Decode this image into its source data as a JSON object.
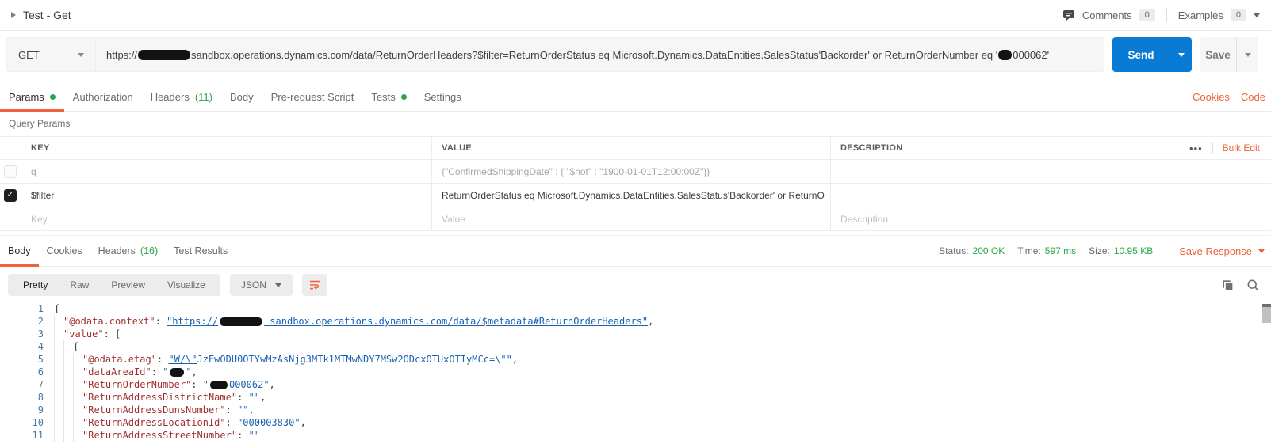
{
  "colors": {
    "accent_orange": "#f0613c",
    "success_green": "#28a745",
    "send_blue": "#0a7bd4",
    "redaction_black": "#131313"
  },
  "header": {
    "request_name": "Test - Get",
    "comments": {
      "label": "Comments",
      "count": "0"
    },
    "examples": {
      "label": "Examples",
      "count": "0"
    }
  },
  "request": {
    "method": "GET",
    "url": {
      "scheme": "https://",
      "rest": "sandbox.operations.dynamics.com/data/ReturnOrderHeaders?$filter=ReturnOrderStatus eq Microsoft.Dynamics.DataEntities.SalesStatus'Backorder' or ReturnOrderNumber eq '",
      "suffix": "000062'"
    },
    "send_label": "Send",
    "save_label": "Save"
  },
  "request_tabs": [
    {
      "label": "Params",
      "dot": true,
      "active": true
    },
    {
      "label": "Authorization"
    },
    {
      "label": "Headers",
      "badge": "(11)"
    },
    {
      "label": "Body"
    },
    {
      "label": "Pre-request Script"
    },
    {
      "label": "Tests",
      "dot": true
    },
    {
      "label": "Settings"
    }
  ],
  "request_links": {
    "cookies": "Cookies",
    "code": "Code"
  },
  "query_params": {
    "title": "Query Params",
    "columns": {
      "key": "KEY",
      "value": "VALUE",
      "description": "DESCRIPTION"
    },
    "more_icon": "•••",
    "bulk_edit": "Bulk Edit",
    "rows": [
      {
        "key": "q",
        "value": "{\"ConfirmedShippingDate\" : { \"$not\" : \"1900-01-01T12:00:00Z\"}}",
        "checked": false
      },
      {
        "key": "$filter",
        "value": "ReturnOrderStatus eq Microsoft.Dynamics.DataEntities.SalesStatus'Backorder' or ReturnO",
        "checked": true
      },
      {
        "key_placeholder": "Key",
        "value_placeholder": "Value",
        "description_placeholder": "Description"
      }
    ]
  },
  "response": {
    "tabs": [
      {
        "label": "Body",
        "active": true
      },
      {
        "label": "Cookies"
      },
      {
        "label": "Headers",
        "badge": "(16)"
      },
      {
        "label": "Test Results"
      }
    ],
    "meta": {
      "status_label": "Status:",
      "status_value": "200 OK",
      "time_label": "Time:",
      "time_value": "597 ms",
      "size_label": "Size:",
      "size_value": "10.95 KB",
      "save_response": "Save Response"
    },
    "toolbar": {
      "views": [
        {
          "label": "Pretty",
          "active": true
        },
        {
          "label": "Raw"
        },
        {
          "label": "Preview"
        },
        {
          "label": "Visualize"
        }
      ],
      "format": "JSON"
    },
    "code": {
      "lines": [
        {
          "num": "1",
          "indent": 0,
          "tokens": [
            {
              "t": "punc",
              "v": "{"
            }
          ]
        },
        {
          "num": "2",
          "indent": 1,
          "tokens": [
            {
              "t": "key",
              "v": "\"@odata.context\""
            },
            {
              "t": "punc",
              "v": ": "
            },
            {
              "t": "link",
              "v": "\"https://"
            },
            {
              "t": "redact",
              "w": 54
            },
            {
              "t": "link",
              "v": " sandbox.operations.dynamics.com/data/$metadata#ReturnOrderHeaders\""
            },
            {
              "t": "punc",
              "v": ","
            }
          ]
        },
        {
          "num": "3",
          "indent": 1,
          "tokens": [
            {
              "t": "key",
              "v": "\"value\""
            },
            {
              "t": "punc",
              "v": ": ["
            }
          ]
        },
        {
          "num": "4",
          "indent": 2,
          "tokens": [
            {
              "t": "punc",
              "v": "{"
            }
          ]
        },
        {
          "num": "5",
          "indent": 3,
          "tokens": [
            {
              "t": "key",
              "v": "\"@odata.etag\""
            },
            {
              "t": "punc",
              "v": ": "
            },
            {
              "t": "stru",
              "v": "\"W/\\\""
            },
            {
              "t": "str",
              "v": "JzEwODU0OTYwMzAsNjg3MTk1MTMwNDY7MSw2ODcxOTUxOTIyMCc=\\\"\""
            },
            {
              "t": "punc",
              "v": ","
            }
          ]
        },
        {
          "num": "6",
          "indent": 3,
          "tokens": [
            {
              "t": "key",
              "v": "\"dataAreaId\""
            },
            {
              "t": "punc",
              "v": ": "
            },
            {
              "t": "str",
              "v": "\""
            },
            {
              "t": "redact",
              "w": 18
            },
            {
              "t": "str",
              "v": "\""
            },
            {
              "t": "punc",
              "v": ","
            }
          ]
        },
        {
          "num": "7",
          "indent": 3,
          "tokens": [
            {
              "t": "key",
              "v": "\"ReturnOrderNumber\""
            },
            {
              "t": "punc",
              "v": ": "
            },
            {
              "t": "str",
              "v": "\""
            },
            {
              "t": "redact",
              "w": 22
            },
            {
              "t": "str",
              "v": "000062\""
            },
            {
              "t": "punc",
              "v": ","
            }
          ]
        },
        {
          "num": "8",
          "indent": 3,
          "tokens": [
            {
              "t": "key",
              "v": "\"ReturnAddressDistrictName\""
            },
            {
              "t": "punc",
              "v": ": "
            },
            {
              "t": "str",
              "v": "\"\""
            },
            {
              "t": "punc",
              "v": ","
            }
          ]
        },
        {
          "num": "9",
          "indent": 3,
          "tokens": [
            {
              "t": "key",
              "v": "\"ReturnAddressDunsNumber\""
            },
            {
              "t": "punc",
              "v": ": "
            },
            {
              "t": "str",
              "v": "\"\""
            },
            {
              "t": "punc",
              "v": ","
            }
          ]
        },
        {
          "num": "10",
          "indent": 3,
          "tokens": [
            {
              "t": "key",
              "v": "\"ReturnAddressLocationId\""
            },
            {
              "t": "punc",
              "v": ": "
            },
            {
              "t": "str",
              "v": "\"000003830\""
            },
            {
              "t": "punc",
              "v": ","
            }
          ]
        },
        {
          "num": "11",
          "indent": 3,
          "tokens": [
            {
              "t": "key",
              "v": "\"ReturnAddressStreetNumber\""
            },
            {
              "t": "punc",
              "v": ": "
            },
            {
              "t": "str",
              "v": "\"\""
            }
          ]
        }
      ]
    }
  }
}
